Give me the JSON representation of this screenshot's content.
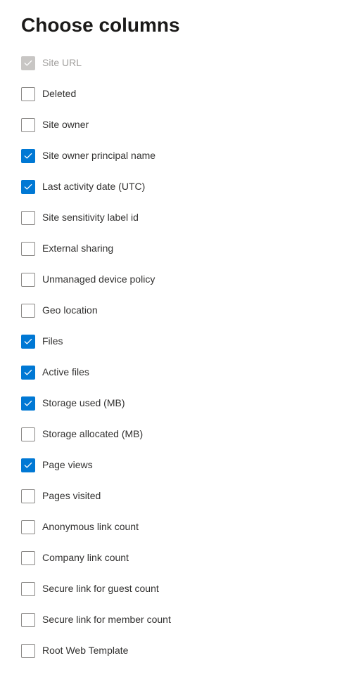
{
  "title": "Choose columns",
  "columns": [
    {
      "label": "Site URL",
      "checked": true,
      "disabled": true
    },
    {
      "label": "Deleted",
      "checked": false,
      "disabled": false
    },
    {
      "label": "Site owner",
      "checked": false,
      "disabled": false
    },
    {
      "label": "Site owner principal name",
      "checked": true,
      "disabled": false
    },
    {
      "label": "Last activity date (UTC)",
      "checked": true,
      "disabled": false
    },
    {
      "label": "Site sensitivity label id",
      "checked": false,
      "disabled": false
    },
    {
      "label": "External sharing",
      "checked": false,
      "disabled": false
    },
    {
      "label": "Unmanaged device policy",
      "checked": false,
      "disabled": false
    },
    {
      "label": "Geo location",
      "checked": false,
      "disabled": false
    },
    {
      "label": "Files",
      "checked": true,
      "disabled": false
    },
    {
      "label": "Active files",
      "checked": true,
      "disabled": false
    },
    {
      "label": "Storage used (MB)",
      "checked": true,
      "disabled": false
    },
    {
      "label": "Storage allocated (MB)",
      "checked": false,
      "disabled": false
    },
    {
      "label": "Page views",
      "checked": true,
      "disabled": false
    },
    {
      "label": "Pages visited",
      "checked": false,
      "disabled": false
    },
    {
      "label": "Anonymous link count",
      "checked": false,
      "disabled": false
    },
    {
      "label": "Company link count",
      "checked": false,
      "disabled": false
    },
    {
      "label": "Secure link for guest count",
      "checked": false,
      "disabled": false
    },
    {
      "label": "Secure link for member count",
      "checked": false,
      "disabled": false
    },
    {
      "label": "Root Web Template",
      "checked": false,
      "disabled": false
    }
  ]
}
